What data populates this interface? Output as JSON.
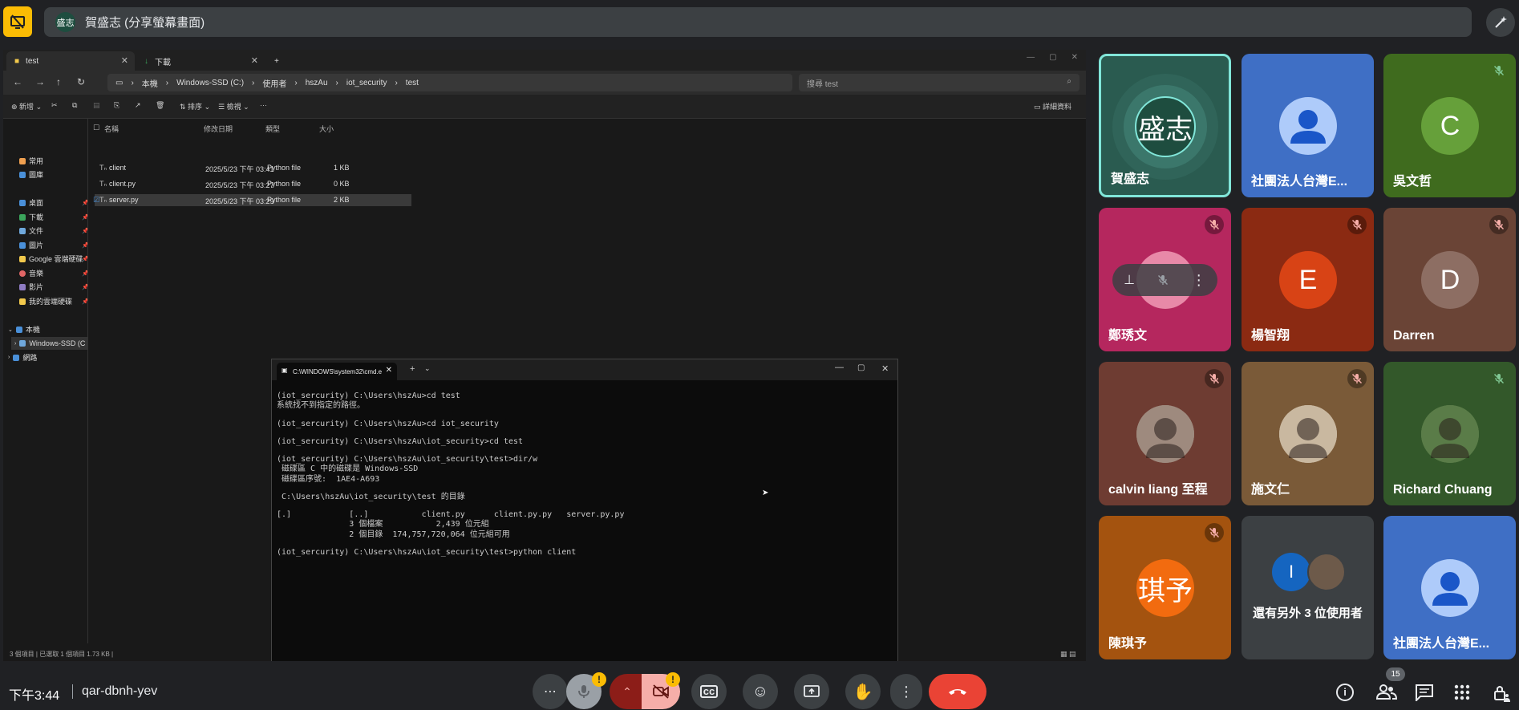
{
  "presentation": {
    "presenter_initials": "盛志",
    "label": "賀盛志 (分享螢幕畫面)"
  },
  "explorer": {
    "tabs": [
      {
        "label": "test",
        "icon": "folder-icon"
      },
      {
        "label": "下載",
        "icon": "download-icon"
      }
    ],
    "breadcrumb": [
      "本機",
      "Windows-SSD (C:)",
      "使用者",
      "hszAu",
      "iot_security",
      "test"
    ],
    "search_placeholder": "搜尋 test",
    "toolbar": {
      "new_label": "新增",
      "sort_label": "排序",
      "view_label": "檢視",
      "details_label": "詳細資料"
    },
    "sidebar": [
      {
        "label": "常用",
        "color": "#f0a050"
      },
      {
        "label": "圖庫",
        "color": "#4a90d9"
      },
      {
        "label": "桌面",
        "color": "#4a90d9"
      },
      {
        "label": "下載",
        "color": "#3ba55c"
      },
      {
        "label": "文件",
        "color": "#6fa8dc"
      },
      {
        "label": "圖片",
        "color": "#4a90d9"
      },
      {
        "label": "Google 雲端硬碟",
        "color": "#f2c94c"
      },
      {
        "label": "音樂",
        "color": "#e06666"
      },
      {
        "label": "影片",
        "color": "#8e7cc3"
      },
      {
        "label": "我的雲端硬碟",
        "color": "#f2c94c"
      },
      {
        "label": "本機",
        "color": "#4a90d9"
      },
      {
        "label": "Windows-SSD (C",
        "color": "#6fa8dc"
      },
      {
        "label": "網路",
        "color": "#4a90d9"
      }
    ],
    "columns": [
      "名稱",
      "修改日期",
      "類型",
      "大小"
    ],
    "files": [
      {
        "name": "client",
        "date": "2025/5/23 下午 03:41",
        "type": "Python file",
        "size": "1 KB"
      },
      {
        "name": "client.py",
        "date": "2025/5/23 下午 03:27",
        "type": "Python file",
        "size": "0 KB"
      },
      {
        "name": "server.py",
        "date": "2025/5/23 下午 03:29",
        "type": "Python file",
        "size": "2 KB"
      }
    ],
    "status": "3 個項目  |  已選取 1 個項目  1.73 KB  |"
  },
  "cmd": {
    "tab_title": "C:\\WINDOWS\\system32\\cmd.e",
    "lines": [
      "(iot_sercurity) C:\\Users\\hszAu>cd test",
      "系統找不到指定的路徑。",
      "",
      "(iot_sercurity) C:\\Users\\hszAu>cd iot_security",
      "",
      "(iot_sercurity) C:\\Users\\hszAu\\iot_security>cd test",
      "",
      "(iot_sercurity) C:\\Users\\hszAu\\iot_security\\test>dir/w",
      " 磁碟區 C 中的磁碟是 Windows-SSD",
      " 磁碟區序號:  1AE4-A693",
      "",
      " C:\\Users\\hszAu\\iot_security\\test 的目錄",
      "",
      "[.]            [..]           client.py      client.py.py   server.py.py",
      "               3 個檔案           2,439 位元組",
      "               2 個目錄  174,757,720,064 位元組可用",
      "",
      "(iot_sercurity) C:\\Users\\hszAu\\iot_security\\test>python client"
    ]
  },
  "participants": [
    {
      "name": "賀盛志",
      "avatar_text": "盛志",
      "bg": "#2a5b50",
      "avatar_bg": "#1e4d3f",
      "active": true,
      "mic": "none"
    },
    {
      "name": "社團法人台灣E...",
      "avatar_text": "",
      "bg": "#3f6fc5",
      "avatar_bg": "#aecbfa",
      "mic": "none",
      "generic": true
    },
    {
      "name": "吳文哲",
      "avatar_text": "C",
      "bg": "#3f6b1e",
      "avatar_bg": "#66a03a",
      "mic": "speaking"
    },
    {
      "name": "鄭琇文",
      "avatar_text": "",
      "bg": "#b5275e",
      "avatar_bg": "#e889a8",
      "mic": "muted",
      "hover_controls": true
    },
    {
      "name": "楊智翔",
      "avatar_text": "E",
      "bg": "#8b2a12",
      "avatar_bg": "#d84315",
      "mic": "muted"
    },
    {
      "name": "Darren",
      "avatar_text": "D",
      "bg": "#6a4436",
      "avatar_bg": "#8d6e63",
      "mic": "muted"
    },
    {
      "name": "calvin liang 至程",
      "avatar_text": "",
      "bg": "#6e3c32",
      "avatar_bg": "#9e8a7e",
      "mic": "muted",
      "photo": true
    },
    {
      "name": "施文仁",
      "avatar_text": "",
      "bg": "#7a5a38",
      "avatar_bg": "#c9b8a0",
      "mic": "muted",
      "photo": true
    },
    {
      "name": "Richard Chuang",
      "avatar_text": "",
      "bg": "#33582a",
      "avatar_bg": "#5a7c48",
      "mic": "speaking",
      "photo": true
    },
    {
      "name": "陳琪予",
      "avatar_text": "琪予",
      "bg": "#a4530f",
      "avatar_bg": "#f26b0f",
      "mic": "muted"
    },
    {
      "name": "還有另外 3 位使用者",
      "avatar_text": "I",
      "bg": "#3c4043",
      "avatar_bg": "#1565c0",
      "mic": "none",
      "more": true
    },
    {
      "name": "社團法人台灣E...",
      "avatar_text": "",
      "bg": "#3f6fc5",
      "avatar_bg": "#aecbfa",
      "mic": "none",
      "generic": true
    }
  ],
  "bottom": {
    "time": "下午3:44",
    "meeting_code": "qar-dbnh-yev",
    "people_count": "15",
    "warning_mark": "!"
  }
}
